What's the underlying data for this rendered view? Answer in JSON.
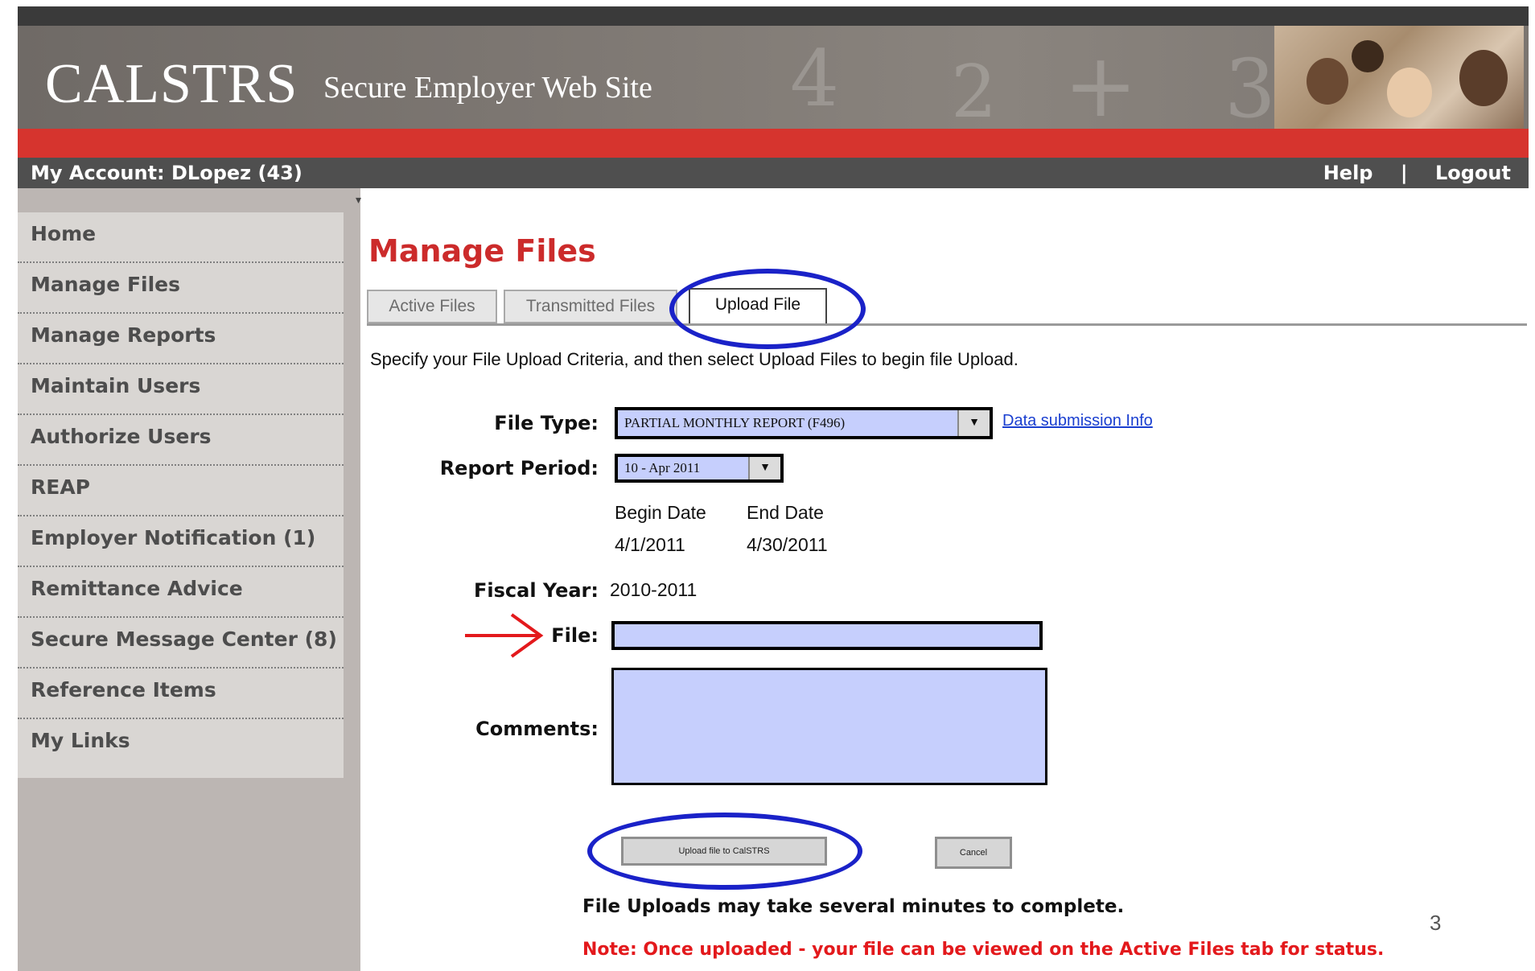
{
  "header": {
    "logo": "CALSTRS",
    "site_title": "Secure Employer Web Site"
  },
  "account_bar": {
    "account": "My Account: DLopez (43)",
    "help": "Help",
    "separator": "|",
    "logout": "Logout"
  },
  "sidebar": {
    "items": [
      {
        "label": "Home"
      },
      {
        "label": "Manage Files"
      },
      {
        "label": "Manage Reports"
      },
      {
        "label": "Maintain Users"
      },
      {
        "label": "Authorize Users"
      },
      {
        "label": "REAP"
      },
      {
        "label": "Employer Notification (1)"
      },
      {
        "label": "Remittance Advice"
      },
      {
        "label": "Secure Message Center (8)"
      },
      {
        "label": "Reference Items"
      },
      {
        "label": "My Links"
      }
    ]
  },
  "main": {
    "title": "Manage Files",
    "tabs": [
      {
        "label": "Active Files"
      },
      {
        "label": "Transmitted Files"
      },
      {
        "label": "Upload File",
        "active": true
      }
    ],
    "instructions": "Specify your File Upload Criteria, and then select Upload Files to begin file Upload.",
    "form": {
      "file_type_label": "File Type:",
      "file_type_value": "PARTIAL MONTHLY REPORT (F496)",
      "data_info_link": "Data submission Info",
      "report_period_label": "Report Period:",
      "report_period_value": "10 - Apr 2011",
      "begin_date_label": "Begin Date",
      "end_date_label": "End Date",
      "begin_date": "4/1/2011",
      "end_date": "4/30/2011",
      "fiscal_year_label": "Fiscal Year:",
      "fiscal_year": "2010-2011",
      "file_label": "File:",
      "file_value": "",
      "comments_label": "Comments:",
      "comments_value": ""
    },
    "buttons": {
      "upload": "Upload file to CalSTRS",
      "cancel": "Cancel"
    },
    "notice": "File Uploads may take several minutes to complete.",
    "note": "Note: Once uploaded - your file can be viewed on the Active Files tab for status."
  },
  "page_number": "3",
  "colors": {
    "brand_red": "#cc2b2b",
    "header_red_bar": "#d6342e",
    "annotation_blue": "#1a22c8",
    "annotation_red_arrow": "#e3191c",
    "input_fill": "#c6cffd"
  },
  "icons": {
    "dropdown": "chevron-down-icon",
    "annotation_arrow": "arrow-right-icon"
  }
}
